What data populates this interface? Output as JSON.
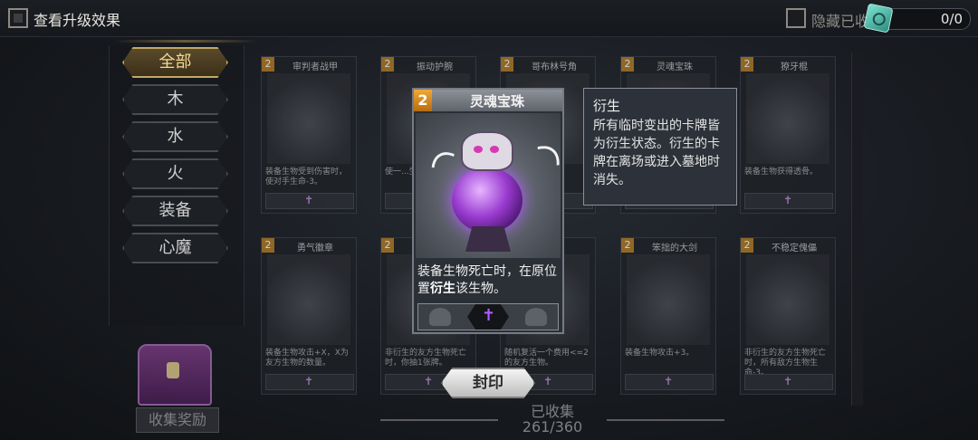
{
  "header": {
    "upgrade_label": "查看升级效果",
    "hide_label": "隐藏已收",
    "counter": "0/0"
  },
  "tabs": [
    "全部",
    "木",
    "水",
    "火",
    "装备",
    "心魔"
  ],
  "active_tab": "全部",
  "cards": [
    {
      "level": "2",
      "title": "审判者战甲",
      "desc": "装备生物受到伤害时，使对手生命-3。"
    },
    {
      "level": "2",
      "title": "振动护腕",
      "desc": "使一...生物获...到回合..."
    },
    {
      "level": "2",
      "title": "哥布林号角",
      "desc": "...生物..."
    },
    {
      "level": "2",
      "title": "灵魂宝珠",
      "desc": ""
    },
    {
      "level": "2",
      "title": "獠牙棍",
      "desc": "装备生物获得透骨。"
    },
    {
      "level": "2",
      "title": "勇气徽章",
      "desc": "装备生物攻击+X，X为友方生物的数量。"
    },
    {
      "level": "2",
      "title": "",
      "desc": "非衍生的友方生物死亡时，你抽1张牌。"
    },
    {
      "level": "2",
      "title": "",
      "desc": "随机复活一个费用<=2的友方生物。"
    },
    {
      "level": "2",
      "title": "笨拙的大剑",
      "desc": "装备生物攻击+3。"
    },
    {
      "level": "2",
      "title": "不稳定傀儡",
      "desc": "非衍生的友方生物死亡时，所有敌方生物生命-3。"
    }
  ],
  "reward_label": "收集奖励",
  "collection": {
    "label": "已收集",
    "count": "261/360"
  },
  "popup_card": {
    "level": "2",
    "title": "灵魂宝珠",
    "desc_before": "装备生物死亡时，在原位置",
    "desc_keyword": "衍生",
    "desc_after": "该生物。"
  },
  "tooltip": {
    "title": "衍生",
    "body": "所有临时变出的卡牌皆为衍生状态。衍生的卡牌在离场或进入墓地时消失。"
  },
  "seal_button": "封印",
  "colors": {
    "accent": "#f0a834",
    "purple": "#b35cff",
    "gold": "#c4a866"
  }
}
